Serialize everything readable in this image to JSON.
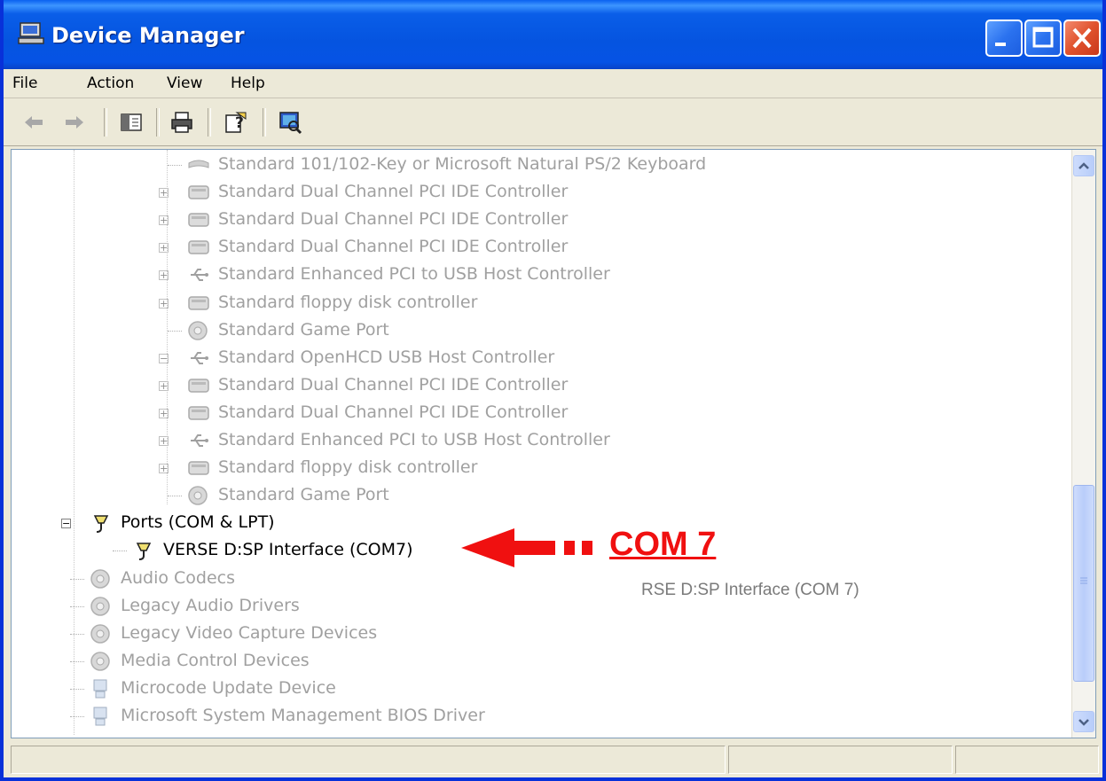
{
  "window": {
    "title": "Device Manager"
  },
  "menu": {
    "file": "File",
    "action": "Action",
    "view": "View",
    "help": "Help"
  },
  "toolbar": {
    "buttons": [
      "back-icon",
      "forward-icon",
      "show-hide-console-tree-icon",
      "print-icon",
      "help-icon",
      "scan-hardware-icon"
    ]
  },
  "tree": {
    "rows": [
      {
        "label": "Standard 101/102-Key or Microsoft Natural PS/2 Keyboard",
        "icon": "keyboard-icon",
        "expander": "none",
        "level": 3,
        "state": "gray"
      },
      {
        "label": "Standard Dual Channel PCI IDE Controller",
        "icon": "ide-controller-icon",
        "expander": "+",
        "level": 3,
        "state": "gray"
      },
      {
        "label": "Standard Dual Channel PCI IDE Controller",
        "icon": "ide-controller-icon",
        "expander": "+",
        "level": 3,
        "state": "gray"
      },
      {
        "label": "Standard Dual Channel PCI IDE Controller",
        "icon": "ide-controller-icon",
        "expander": "+",
        "level": 3,
        "state": "gray"
      },
      {
        "label": "Standard Enhanced PCI to USB Host Controller",
        "icon": "usb-icon",
        "expander": "+",
        "level": 3,
        "state": "gray"
      },
      {
        "label": "Standard floppy disk controller",
        "icon": "ide-controller-icon",
        "expander": "+",
        "level": 3,
        "state": "gray"
      },
      {
        "label": "Standard Game Port",
        "icon": "sound-icon",
        "expander": "none",
        "level": 3,
        "state": "gray"
      },
      {
        "label": "Standard OpenHCD USB Host Controller",
        "icon": "usb-icon",
        "expander": "-",
        "level": 3,
        "state": "gray"
      },
      {
        "label": "Standard Dual Channel PCI IDE Controller",
        "icon": "ide-controller-icon",
        "expander": "+",
        "level": 3,
        "state": "gray"
      },
      {
        "label": "Standard Dual Channel PCI IDE Controller",
        "icon": "ide-controller-icon",
        "expander": "+",
        "level": 3,
        "state": "gray"
      },
      {
        "label": "Standard Enhanced PCI to USB Host Controller",
        "icon": "usb-icon",
        "expander": "+",
        "level": 3,
        "state": "gray"
      },
      {
        "label": "Standard floppy disk controller",
        "icon": "ide-controller-icon",
        "expander": "+",
        "level": 3,
        "state": "gray"
      },
      {
        "label": "Standard Game Port",
        "icon": "sound-icon",
        "expander": "none",
        "level": 3,
        "state": "gray"
      },
      {
        "label": "Ports (COM & LPT)",
        "icon": "port-icon",
        "expander": "-",
        "level": 1,
        "state": "black"
      },
      {
        "label": "VERSE D:SP Interface (COM7)",
        "icon": "port-icon",
        "expander": "none",
        "level": 2,
        "state": "black"
      },
      {
        "label": "Audio Codecs",
        "icon": "sound-icon",
        "expander": "none",
        "level": 1,
        "state": "gray"
      },
      {
        "label": "Legacy Audio Drivers",
        "icon": "sound-icon",
        "expander": "none",
        "level": 1,
        "state": "gray"
      },
      {
        "label": "Legacy Video Capture Devices",
        "icon": "sound-icon",
        "expander": "none",
        "level": 1,
        "state": "gray"
      },
      {
        "label": "Media Control Devices",
        "icon": "sound-icon",
        "expander": "none",
        "level": 1,
        "state": "gray"
      },
      {
        "label": "Microcode Update Device",
        "icon": "computer-icon",
        "expander": "none",
        "level": 1,
        "state": "gray"
      },
      {
        "label": "Microsoft System Management BIOS Driver",
        "icon": "computer-icon",
        "expander": "none",
        "level": 1,
        "state": "gray"
      }
    ]
  },
  "annotation": {
    "overlay_text": "RSE D:SP Interface (COM 7)",
    "callout": "COM 7",
    "arrow_color": "#f01010"
  },
  "colors": {
    "titlebar": "#0554e0",
    "disabled_text": "#a0a0a0",
    "annotation": "#f01010"
  }
}
